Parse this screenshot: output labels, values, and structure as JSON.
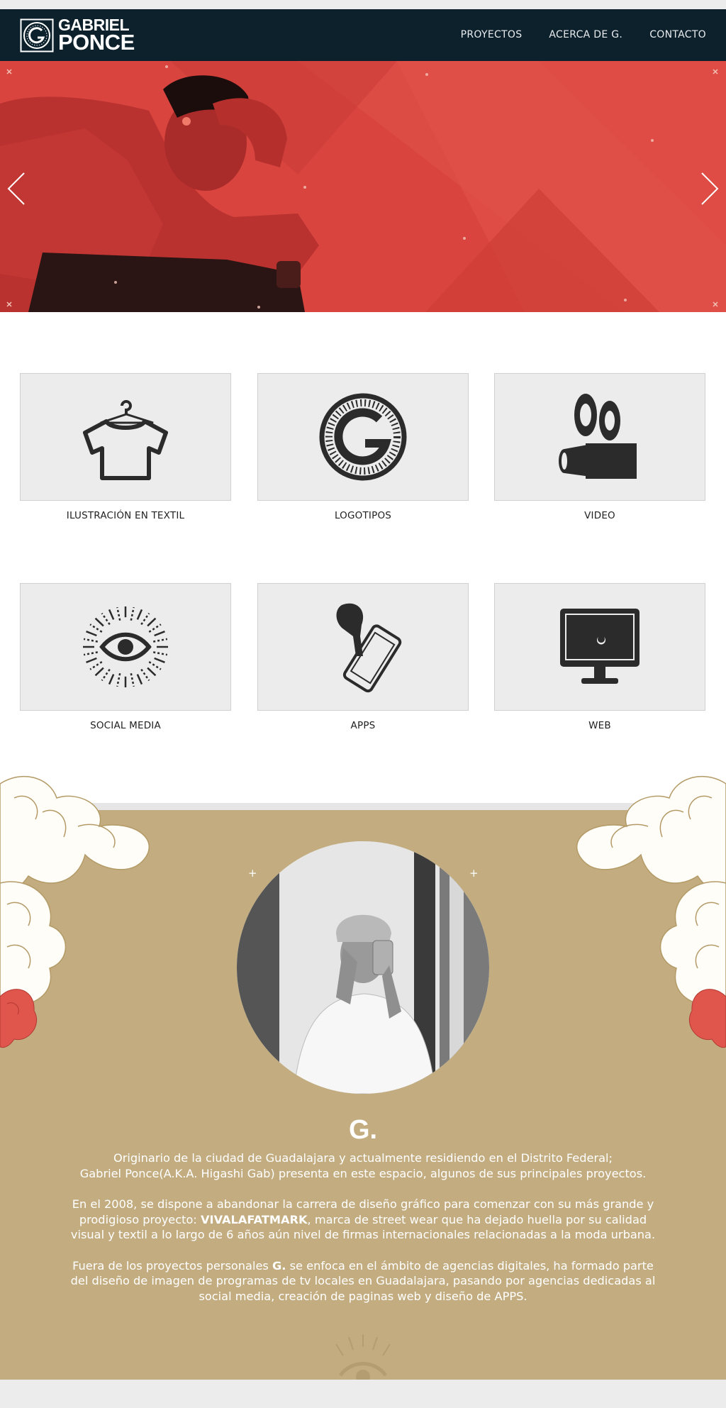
{
  "header": {
    "logo_line1": "GABRIEL",
    "logo_line2": "PONCE",
    "nav": [
      "PROYECTOS",
      "ACERCA DE G.",
      "CONTACTO"
    ]
  },
  "hero": {
    "accent": "#d9443e",
    "prev_icon": "chevron-left-icon",
    "next_icon": "chevron-right-icon"
  },
  "categories": [
    {
      "label": "ILUSTRACIÓN EN TEXTIL",
      "icon": "tshirt-hanger-icon"
    },
    {
      "label": "LOGOTIPOS",
      "icon": "g-logo-icon"
    },
    {
      "label": "VIDEO",
      "icon": "film-camera-icon"
    },
    {
      "label": "SOCIAL MEDIA",
      "icon": "eye-icon"
    },
    {
      "label": "APPS",
      "icon": "smartphone-tap-icon"
    },
    {
      "label": "WEB",
      "icon": "monitor-icon"
    }
  ],
  "about": {
    "background": "#c3ad80",
    "mark": "G.",
    "p1a": "Originario de la ciudad de  Guadalajara y actualmente residiendo en el Distrito Federal;",
    "p1b": "Gabriel Ponce(A.K.A. Higashi Gab) presenta en este espacio, algunos de sus principales proyectos.",
    "p2_before": "En el 2008, se dispone a abandonar la carrera de diseño gráfico para comenzar con su más grande y prodigioso proyecto: ",
    "p2_bold": "VIVALAFATMARK",
    "p2_after": ", marca  de street wear que ha dejado huella por su calidad visual y textil a lo largo de 6 años aún nivel de firmas internacionales relacionadas a la moda urbana.",
    "p3_before": "Fuera de los proyectos personales ",
    "p3_bold": "G.",
    "p3_after": " se enfoca en el ámbito de agencias digitales, ha formado parte del diseño de imagen de programas de tv locales en Guadalajara, pasando por agencias dedicadas al social media, creación de paginas web y diseño de APPS."
  }
}
